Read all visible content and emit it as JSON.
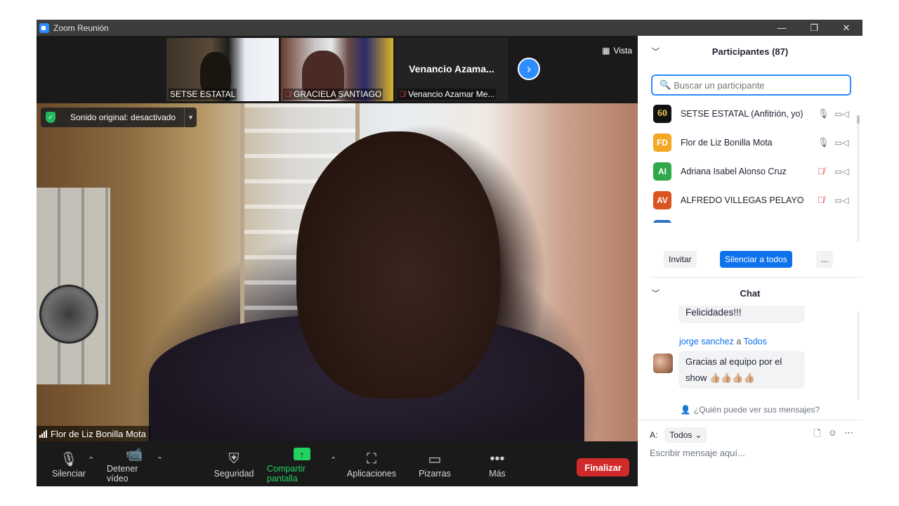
{
  "window": {
    "title": "Zoom Reunión",
    "controls": {
      "minimize": "—",
      "restore": "❐",
      "close": "✕"
    }
  },
  "thumbnails": [
    {
      "name": "SETSE ESTATAL",
      "muted": false
    },
    {
      "name": "GRACIELA SANTIAGO",
      "muted": true
    },
    {
      "name": "Venancio Azamar Me...",
      "title": "Venancio  Azama...",
      "muted": true
    }
  ],
  "view": {
    "label": "Vista"
  },
  "sound_badge": {
    "label": "Sonido original: desactivado"
  },
  "speaker": {
    "name": "Flor de Liz Bonilla Mota"
  },
  "toolbar": {
    "mute": "Silenciar",
    "stop_video": "Detener vídeo",
    "security": "Seguridad",
    "share": "Compartir pantalla",
    "apps": "Aplicaciones",
    "whiteboards": "Pizarras",
    "more": "Más",
    "end": "Finalizar"
  },
  "participants": {
    "title": "Participantes (87)",
    "search_placeholder": "Buscar un participante",
    "list": [
      {
        "initials": "60",
        "name": "SETSE ESTATAL (Anfitrión, yo)",
        "color": "#111111",
        "mic": "on"
      },
      {
        "initials": "FD",
        "name": "Flor de Liz Bonilla Mota",
        "color": "#f5a623",
        "mic": "on"
      },
      {
        "initials": "AI",
        "name": "Adriana Isabel Alonso Cruz",
        "color": "#2ea84a",
        "mic": "off"
      },
      {
        "initials": "AV",
        "name": "ALFREDO VILLEGAS PELAYO",
        "color": "#d9541e",
        "mic": "off"
      }
    ],
    "invite": "Invitar",
    "mute_all": "Silenciar a todos",
    "more": "..."
  },
  "chat": {
    "title": "Chat",
    "messages": [
      {
        "text": "Felicidades!!!"
      },
      {
        "sender": "jorge sanchez",
        "connector": "a",
        "recipient": "Todos",
        "text": "Gracias al equipo por el show 👍🏼👍🏼👍🏼👍🏼"
      }
    ],
    "who_can_see": "¿Quién puede ver sus mensajes?",
    "to_label": "A:",
    "to_value": "Todos",
    "compose_placeholder": "Escribir mensaje aquí..."
  }
}
